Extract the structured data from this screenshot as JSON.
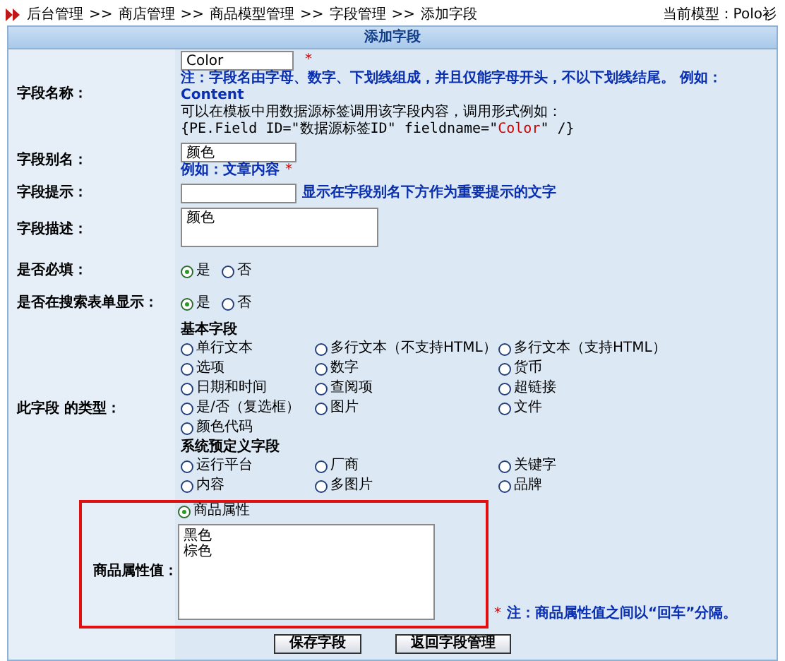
{
  "breadcrumb": [
    "后台管理",
    ">>",
    "商店管理",
    ">>",
    "商品模型管理",
    ">>",
    "字段管理",
    ">>",
    "添加字段"
  ],
  "current_model": "当前模型：Polo衫",
  "form_title": "添加字段",
  "field_name": {
    "label": "字段名称：",
    "value": "Color",
    "required_mark": "*",
    "note": "注：字段名由字母、数字、下划线组成，并且仅能字母开头，不以下划线结尾。 例如：Content",
    "usage": "可以在模板中用数据源标签调用该字段内容，调用形式例如：",
    "code": {
      "before": "{PE.Field ID=\"数据源标签ID\" fieldname=\"",
      "field": "Color",
      "after": "\" /}"
    }
  },
  "field_alias": {
    "label": "字段别名：",
    "value": "颜色",
    "example": "例如：文章内容",
    "required_mark": "*"
  },
  "field_hint": {
    "label": "字段提示：",
    "help": "显示在字段别名下方作为重要提示的文字"
  },
  "field_description": {
    "label": "字段描述：",
    "value": "颜色"
  },
  "required": {
    "label": "是否必填：",
    "options": [
      {
        "label": "是",
        "selected": true
      },
      {
        "label": "否",
        "selected": false
      }
    ]
  },
  "show_in_search": {
    "label": "是否在搜索表单显示：",
    "options": [
      {
        "label": "是",
        "selected": true
      },
      {
        "label": "否",
        "selected": false
      }
    ]
  },
  "field_type": {
    "label": "此字段 的类型：",
    "groups": [
      {
        "title": "基本字段",
        "options": [
          {
            "label": "单行文本",
            "selected": false
          },
          {
            "label": "多行文本（不支持HTML）",
            "selected": false
          },
          {
            "label": "多行文本（支持HTML）",
            "selected": false
          },
          {
            "label": "选项",
            "selected": false
          },
          {
            "label": "数字",
            "selected": false
          },
          {
            "label": "货币",
            "selected": false
          },
          {
            "label": "日期和时间",
            "selected": false
          },
          {
            "label": "查阅项",
            "selected": false
          },
          {
            "label": "超链接",
            "selected": false
          },
          {
            "label": "是/否（复选框）",
            "selected": false
          },
          {
            "label": "图片",
            "selected": false
          },
          {
            "label": "文件",
            "selected": false
          },
          {
            "label": "颜色代码",
            "selected": false
          }
        ]
      },
      {
        "title": "系统预定义字段",
        "options": [
          {
            "label": "运行平台",
            "selected": false
          },
          {
            "label": "厂商",
            "selected": false
          },
          {
            "label": "关键字",
            "selected": false
          },
          {
            "label": "内容",
            "selected": false
          },
          {
            "label": "多图片",
            "selected": false
          },
          {
            "label": "品牌",
            "selected": false
          }
        ]
      }
    ],
    "attribute_option": {
      "label": "商品属性",
      "selected": true
    }
  },
  "attribute_values": {
    "label": "商品属性值：",
    "lines": [
      "黑色",
      "棕色"
    ],
    "required_mark": "*",
    "note": "注：商品属性值之间以“回车”分隔。"
  },
  "buttons": [
    {
      "label": "保存字段"
    },
    {
      "label": "返回字段管理"
    }
  ]
}
